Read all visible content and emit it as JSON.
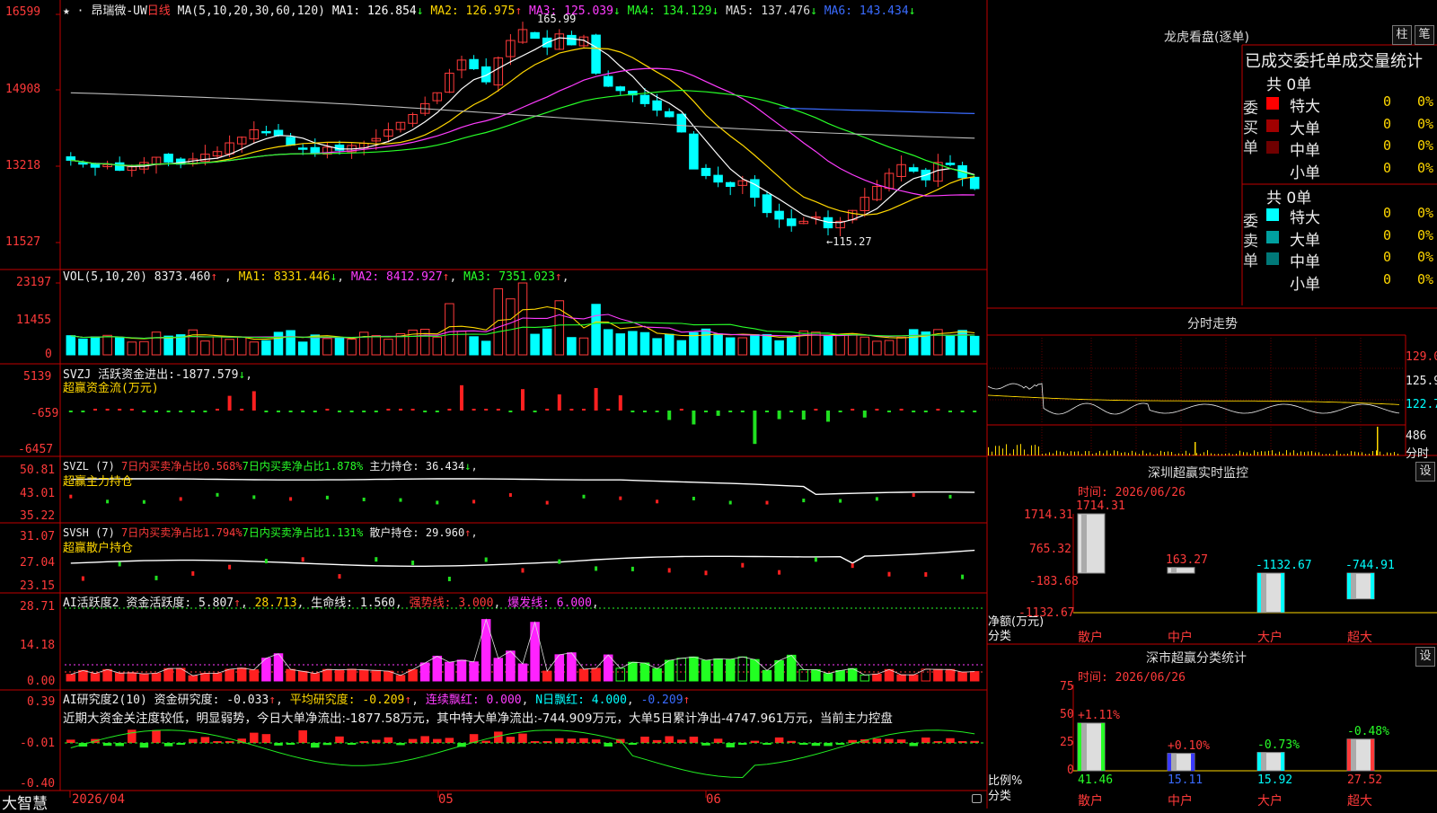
{
  "app": {
    "brand": "大智慧",
    "stock_name": "昂瑞微-UW",
    "period": "日线"
  },
  "price_panel": {
    "ma_label": "MA(5,10,20,30,60,120)",
    "ma": [
      {
        "label": "MA1:",
        "value": "126.854",
        "arrow": "↓",
        "color": "#ffffff"
      },
      {
        "label": "MA2:",
        "value": "126.975",
        "arrow": "↑",
        "color": "#ffd700"
      },
      {
        "label": "MA3:",
        "value": "125.039",
        "arrow": "↓",
        "color": "#ff3cff"
      },
      {
        "label": "MA4:",
        "value": "134.129",
        "arrow": "↓",
        "color": "#28ff28"
      },
      {
        "label": "MA5:",
        "value": "137.476",
        "arrow": "↓",
        "color": "#dddddd"
      },
      {
        "label": "MA6:",
        "value": "143.434",
        "arrow": "↓",
        "color": "#3a6bff"
      }
    ],
    "y_ticks": [
      "16599",
      "14908",
      "13218",
      "11527"
    ],
    "high_label": "165.99",
    "low_label": "←115.27"
  },
  "vol_panel": {
    "label": "VOL(5,10,20)",
    "value": "8373.460",
    "value_arrow": "↑",
    "ma": [
      {
        "label": "MA1:",
        "value": "8331.446",
        "arrow": "↓",
        "color": "#ffd700"
      },
      {
        "label": "MA2:",
        "value": "8412.927",
        "arrow": "↑",
        "color": "#ff3cff"
      },
      {
        "label": "MA3:",
        "value": "7351.023",
        "arrow": "↑",
        "color": "#28ff28"
      }
    ],
    "y_ticks": [
      "23197",
      "11455",
      "0"
    ]
  },
  "svzj_panel": {
    "label": "SVZJ",
    "item": "活跃资金进出:",
    "value": "-1877.579",
    "arrow": "↓",
    "sub": "超赢资金流(万元)",
    "y_ticks": [
      "5139",
      "-659",
      "-6457"
    ]
  },
  "svzl_panel": {
    "label": "SVZL (7)",
    "a": "7日内买卖净占比0.568%",
    "b": "7日内买卖净占比1.878%",
    "c": "主力持仓: 36.434",
    "c_arrow": "↓",
    "sub": "超赢主力持仓",
    "y_ticks": [
      "50.81",
      "43.01",
      "35.22"
    ]
  },
  "svsh_panel": {
    "label": "SVSH (7)",
    "a": "7日内买卖净占比1.794%",
    "b": "7日内买卖净占比1.131%",
    "c": "散户持仓: 29.960",
    "c_arrow": "↑",
    "sub": "超赢散户持仓",
    "y_ticks": [
      "31.07",
      "27.04",
      "23.15"
    ]
  },
  "ai_active_panel": {
    "label": "AI活跃度2",
    "a": "资金活跃度: 5.807",
    "a_arrow": "↑",
    "b": "28.713",
    "c": "生命线: 1.560",
    "d": "强势线: 3.000",
    "e": "爆发线: 6.000",
    "y_ticks": [
      "28.71",
      "14.18",
      "0.00"
    ]
  },
  "ai_research_panel": {
    "label": "AI研究度2(10)",
    "a": "资金研究度: -0.033",
    "a_arrow": "↑",
    "b": "平均研究度: -0.209",
    "b_arrow": "↑",
    "c": "连续飘红: 0.000",
    "d": "N日飘红: 4.000",
    "e": "-0.209",
    "e_arrow": "↑",
    "comment": "近期大资金关注度较低，明显弱势，今日大单净流出:-1877.58万元，其中特大单净流出:-744.909万元，大单5日累计净出-4747.961万元，当前主力控盘",
    "y_ticks": [
      "0.39",
      "-0.01",
      "-0.40"
    ]
  },
  "x_axis": {
    "labels": [
      "2026/04",
      "05",
      "06"
    ]
  },
  "dragon_tiger": {
    "title": "龙虎看盘(逐单)",
    "btn1": "柱",
    "btn2": "笔",
    "header": "已成交委托单成交量统计",
    "buy": {
      "side": "委买单",
      "total": "共 0单",
      "rows": [
        {
          "name": "特大",
          "qty": "0",
          "pct": "0%",
          "color": "#ff0000"
        },
        {
          "name": "大单",
          "qty": "0",
          "pct": "0%",
          "color": "#a00000"
        },
        {
          "name": "中单",
          "qty": "0",
          "pct": "0%",
          "color": "#700000"
        },
        {
          "name": "小单",
          "qty": "0",
          "pct": "0%",
          "color": ""
        }
      ]
    },
    "sell": {
      "side": "委卖单",
      "total": "共 0单",
      "rows": [
        {
          "name": "特大",
          "qty": "0",
          "pct": "0%",
          "color": "#00ffff"
        },
        {
          "name": "大单",
          "qty": "0",
          "pct": "0%",
          "color": "#00a0a0"
        },
        {
          "name": "中单",
          "qty": "0",
          "pct": "0%",
          "color": "#007878"
        },
        {
          "name": "小单",
          "qty": "0",
          "pct": "0%",
          "color": ""
        }
      ]
    }
  },
  "intraday": {
    "title": "分时走势",
    "y_ticks": [
      "129.0",
      "125.9",
      "122.7",
      "486",
      "分时"
    ]
  },
  "sz_monitor": {
    "title": "深圳超赢实时监控",
    "btn": "设",
    "date": "时间: 2026/06/26",
    "y_ticks": [
      "1714.31",
      "765.32",
      "-183.68",
      "-1132.67"
    ],
    "ylabel1": "净额(万元)",
    "ylabel2": "分类",
    "categories": [
      "散户",
      "中户",
      "大户",
      "超大"
    ],
    "values": [
      1714.31,
      163.27,
      -1132.67,
      -744.91
    ],
    "value_labels": [
      "1714.31",
      "163.27",
      "-1132.67",
      "-744.91"
    ]
  },
  "sz_class": {
    "title": "深市超赢分类统计",
    "btn": "设",
    "date": "时间: 2026/06/26",
    "y_ticks": [
      "75",
      "50",
      "25",
      "0"
    ],
    "ylabel1": "比例%",
    "ylabel2": "分类",
    "categories": [
      "散户",
      "中户",
      "大户",
      "超大"
    ],
    "values": [
      41.46,
      15.11,
      15.92,
      27.52
    ],
    "changes": [
      "+1.11%",
      "+0.10%",
      "-0.73%",
      "-0.48%"
    ]
  }
}
